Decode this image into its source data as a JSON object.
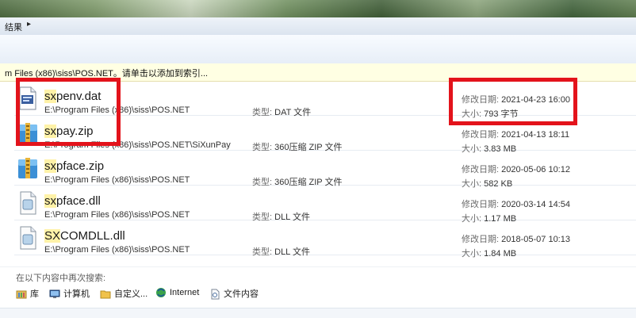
{
  "breadcrumb": {
    "label": "结果"
  },
  "infobar": {
    "text": "m Files (x86)\\siss\\POS.NET。请单击以添加到索引..."
  },
  "results": [
    {
      "name_hl": "sx",
      "name_rest": "penv.dat",
      "path": "E:\\Program Files (x86)\\siss\\POS.NET",
      "type_key": "类型:",
      "type_val": "DAT 文件",
      "date_key": "修改日期:",
      "date_val": "2021-04-23 16:00",
      "size_key": "大小:",
      "size_val": "793 字节",
      "icon": "dat-file-icon"
    },
    {
      "name_hl": "sx",
      "name_rest": "pay.zip",
      "path": "E:\\Program Files (x86)\\siss\\POS.NET\\SiXunPay",
      "type_key": "类型:",
      "type_val": "360压缩 ZIP 文件",
      "date_key": "修改日期:",
      "date_val": "2021-04-13 18:11",
      "size_key": "大小:",
      "size_val": "3.83 MB",
      "icon": "zip-file-icon"
    },
    {
      "name_hl": "sx",
      "name_rest": "pface.zip",
      "path": "E:\\Program Files (x86)\\siss\\POS.NET",
      "type_key": "类型:",
      "type_val": "360压缩 ZIP 文件",
      "date_key": "修改日期:",
      "date_val": "2020-05-06 10:12",
      "size_key": "大小:",
      "size_val": "582 KB",
      "icon": "zip-file-icon"
    },
    {
      "name_hl": "sx",
      "name_rest": "pface.dll",
      "path": "E:\\Program Files (x86)\\siss\\POS.NET",
      "type_key": "类型:",
      "type_val": "DLL 文件",
      "date_key": "修改日期:",
      "date_val": "2020-03-14 14:54",
      "size_key": "大小:",
      "size_val": "1.17 MB",
      "icon": "dll-file-icon"
    },
    {
      "name_hl": "SX",
      "name_rest": "COMDLL.dll",
      "path": "E:\\Program Files (x86)\\siss\\POS.NET",
      "type_key": "类型:",
      "type_val": "DLL 文件",
      "date_key": "修改日期:",
      "date_val": "2018-05-07 10:13",
      "size_key": "大小:",
      "size_val": "1.84 MB",
      "icon": "dll-file-icon"
    }
  ],
  "search_again": {
    "label": "在以下内容中再次搜索:",
    "links": [
      {
        "label": "库",
        "icon": "library-icon"
      },
      {
        "label": "计算机",
        "icon": "computer-icon"
      },
      {
        "label": "自定义...",
        "icon": "custom-folder-icon"
      },
      {
        "label": "Internet",
        "icon": "internet-icon"
      },
      {
        "label": "文件内容",
        "icon": "file-content-icon"
      }
    ]
  },
  "colors": {
    "highlight": "#fff2a8",
    "annotation_red": "#e3131b",
    "infobar": "#ffffe3"
  }
}
